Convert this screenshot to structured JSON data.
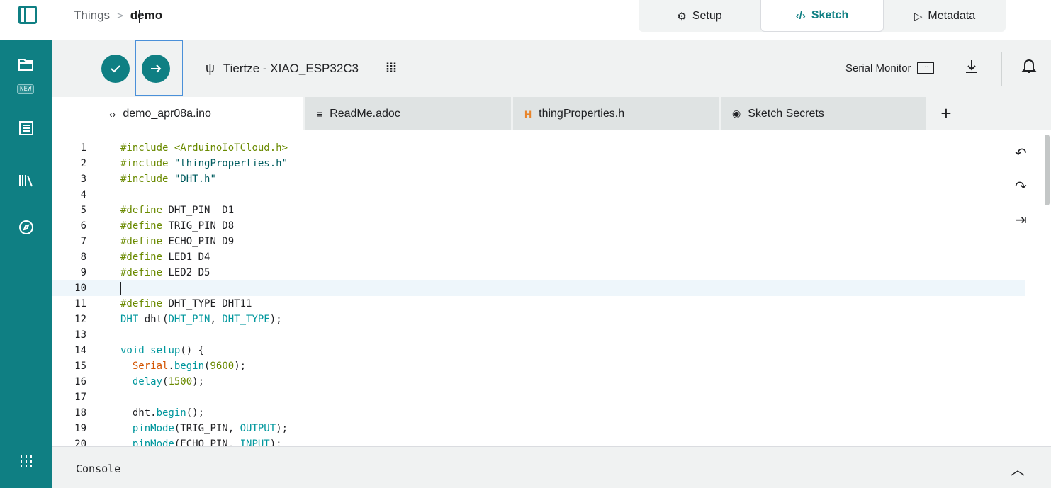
{
  "breadcrumb": {
    "root": "Things",
    "separator": ">",
    "current": "demo"
  },
  "view_tabs": [
    {
      "label": "Setup",
      "icon": "gear-icon"
    },
    {
      "label": "Sketch",
      "icon": "code-icon",
      "active": true
    },
    {
      "label": "Metadata",
      "icon": "tag-icon"
    }
  ],
  "sidebar": {
    "new_badge": "NEW",
    "items": [
      {
        "name": "sketchbook",
        "icon": "folder-icon"
      },
      {
        "name": "examples",
        "icon": "list-icon"
      },
      {
        "name": "libraries",
        "icon": "library-icon"
      },
      {
        "name": "reference",
        "icon": "compass-icon"
      },
      {
        "name": "settings",
        "icon": "sliders-icon"
      }
    ]
  },
  "toolbar": {
    "board_name": "Tiertze - XIAO_ESP32C3",
    "serial_monitor": "Serial Monitor"
  },
  "file_tabs": [
    {
      "label": "demo_apr08a.ino",
      "icon": "code-icon",
      "active": true
    },
    {
      "label": "ReadMe.adoc",
      "icon": "menu-icon"
    },
    {
      "label": "thingProperties.h",
      "icon": "h-file-icon"
    },
    {
      "label": "Sketch Secrets",
      "icon": "eye-icon"
    }
  ],
  "editor": {
    "current_line": 10,
    "lines": [
      "#include <ArduinoIoTCloud.h>",
      "#include \"thingProperties.h\"",
      "#include \"DHT.h\"",
      "",
      "#define DHT_PIN  D1",
      "#define TRIG_PIN D8",
      "#define ECHO_PIN D9",
      "#define LED1 D4",
      "#define LED2 D5",
      "",
      "#define DHT_TYPE DHT11",
      "DHT dht(DHT_PIN, DHT_TYPE);",
      "",
      "void setup() {",
      "  Serial.begin(9600);",
      "  delay(1500);",
      "",
      "  dht.begin();",
      "  pinMode(TRIG_PIN, OUTPUT);",
      "  pinMode(ECHO_PIN, INPUT);"
    ]
  },
  "console": {
    "label": "Console"
  }
}
